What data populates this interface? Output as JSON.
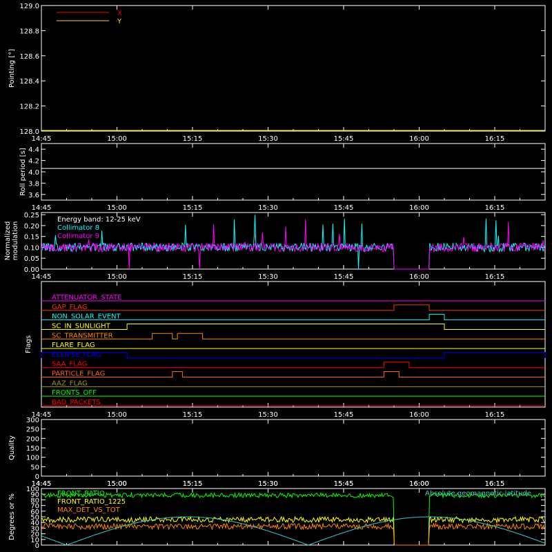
{
  "chart_data": [
    {
      "type": "line",
      "ylabel": "Pointing [°]",
      "ylim": [
        128.0,
        129.0
      ],
      "yticks": [
        "128.0",
        "128.2",
        "128.4",
        "128.6",
        "128.8",
        "129.0"
      ],
      "series": [
        {
          "name": "X",
          "color": "#ff0000",
          "values": []
        },
        {
          "name": "Y",
          "color": "#ffd700",
          "values": []
        }
      ]
    },
    {
      "type": "line",
      "ylabel": "Roll period [s]",
      "ylim": [
        3.5,
        4.5
      ],
      "yticks": [
        "3.6",
        "3.8",
        "4.0",
        "4.2",
        "4.4"
      ],
      "series": [
        {
          "name": "",
          "color": "#ffffff",
          "value": 4.06
        }
      ]
    },
    {
      "type": "line",
      "ylabel": "Normalized modulation",
      "ylim": [
        0,
        0.26
      ],
      "yticks": [
        "0.00",
        "0.05",
        "0.10",
        "0.15",
        "0.20",
        "0.25"
      ],
      "annotation": "Energy band: 12-25 keV",
      "series": [
        {
          "name": "Collimator 8",
          "color": "#00ffff",
          "mean": 0.1
        },
        {
          "name": "Collimator 9",
          "color": "#ff00ff",
          "mean": 0.1
        }
      ],
      "gap": [
        "15:55",
        "16:02"
      ]
    },
    {
      "type": "line",
      "ylabel": "Flags",
      "flags": [
        {
          "name": "ATTENUATOR_STATE",
          "color": "#ff00ff",
          "on": []
        },
        {
          "name": "GAP_FLAG",
          "color": "#ff3300",
          "on": [
            [
              "15:55",
              "16:02"
            ]
          ]
        },
        {
          "name": "NON_SOLAR_EVENT",
          "color": "#00ffff",
          "on": [
            [
              "16:02",
              "16:05"
            ]
          ]
        },
        {
          "name": "SC_IN_SUNLIGHT",
          "color": "#ffff00",
          "on": [
            [
              "15:02",
              "16:05"
            ]
          ]
        },
        {
          "name": "SC_TRANSMITTER",
          "color": "#ff8800",
          "on": [
            [
              "15:07",
              "15:11"
            ],
            [
              "15:12",
              "15:17"
            ]
          ]
        },
        {
          "name": "FLARE_FLAG",
          "color": "#ffff00",
          "on": []
        },
        {
          "name": "ECLIPSE_FLAG",
          "color": "#0000ff",
          "on": [
            [
              "14:45",
              "15:02"
            ],
            [
              "16:05",
              "16:25"
            ]
          ]
        },
        {
          "name": "SAA_FLAG",
          "color": "#ff0000",
          "on": [
            [
              "15:53",
              "15:58"
            ]
          ]
        },
        {
          "name": "PARTICLE_FLAG",
          "color": "#ff6600",
          "on": [
            [
              "15:11",
              "15:13"
            ],
            [
              "15:53",
              "15:56"
            ]
          ]
        },
        {
          "name": "AAZ_FLAG",
          "color": "#999900",
          "on": []
        },
        {
          "name": "FRONTS_OFF",
          "color": "#00ff00",
          "on": []
        },
        {
          "name": "BAD_PACKETS",
          "color": "#ff0000",
          "on": []
        }
      ]
    },
    {
      "type": "line",
      "ylabel": "Quality",
      "ylim": [
        0,
        300
      ],
      "yticks": [
        "0",
        "50",
        "100",
        "150",
        "200",
        "250",
        "300"
      ],
      "series": [
        {
          "name": "",
          "color": "#ffffff",
          "value": 0
        }
      ]
    },
    {
      "type": "line",
      "ylabel": "Degrees or %",
      "ylim": [
        0,
        100
      ],
      "yticks": [
        "0",
        "10",
        "20",
        "30",
        "40",
        "50",
        "60",
        "70",
        "80",
        "90",
        "100"
      ],
      "series": [
        {
          "name": "FRONT_RATIO",
          "color": "#00ff00"
        },
        {
          "name": "FRONT_RATIO_1225",
          "color": "#ffff00"
        },
        {
          "name": "MAX_DET_VS_TOT",
          "color": "#ff8800"
        },
        {
          "name": "Absolute geomagnetic latitude",
          "color": "#33cccc"
        }
      ]
    }
  ],
  "xaxis": {
    "range": [
      "14:45",
      "16:25"
    ],
    "ticks": [
      "14:45",
      "15:00",
      "15:15",
      "15:30",
      "15:45",
      "16:00",
      "16:15"
    ]
  },
  "colors": {
    "background": "#000000",
    "axis": "#ffffff"
  }
}
